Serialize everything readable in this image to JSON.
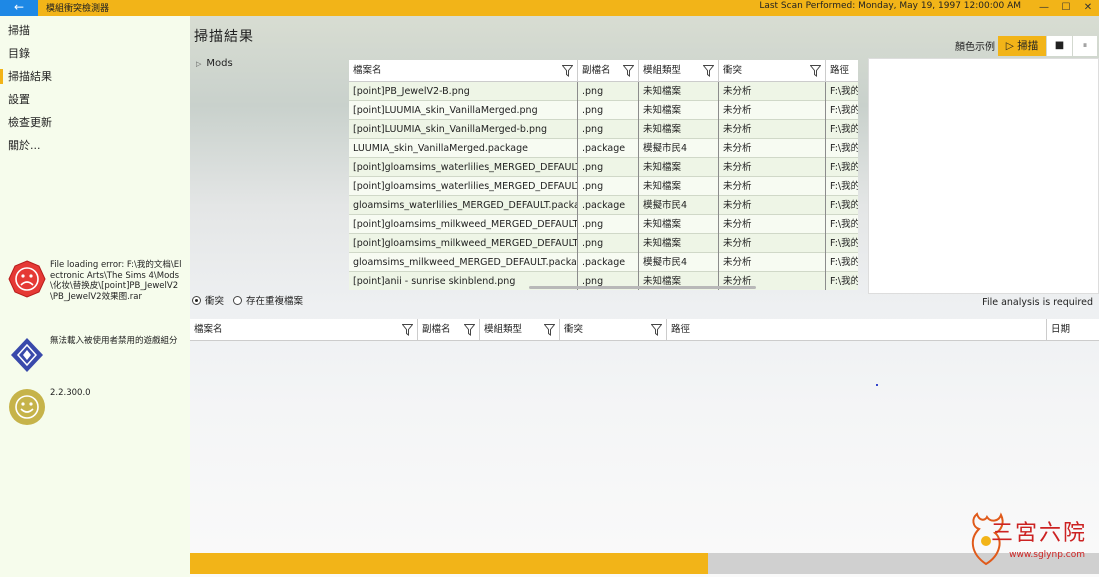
{
  "titlebar": {
    "back_icon": "←",
    "title": "模組衝突檢測器",
    "scan_info": "Last Scan Performed: Monday, May 19, 1997 12:00:00 AM",
    "minimize": "—",
    "maximize": "☐",
    "close": "✕"
  },
  "sidebar": {
    "items": [
      {
        "label": "掃描"
      },
      {
        "label": "目錄"
      },
      {
        "label": "掃描結果"
      },
      {
        "label": "設置"
      },
      {
        "label": "檢查更新"
      },
      {
        "label": "關於..."
      }
    ],
    "active_index": 2,
    "notices": [
      {
        "icon": "error-face-icon",
        "text": "File loading error: F:\\我的文档\\Electronic Arts\\The Sims 4\\Mods\\化妆\\替换皮\\[point]PB_JewelV2\\PB_JewelV2效果图.rar"
      },
      {
        "icon": "diamond-warning-icon",
        "text": "無法載入被使用者禁用的遊戲組分"
      },
      {
        "icon": "smile-face-icon",
        "text": "2.2.300.0"
      }
    ]
  },
  "main": {
    "title": "掃描結果",
    "legend_label": "顏色示例",
    "scan_button": "掃描",
    "scan_icon": "▷",
    "stop_icon": "■",
    "pause_icon": "⏸",
    "tree": {
      "label": "Mods"
    },
    "columns": [
      "檔案名",
      "副檔名",
      "模組類型",
      "衝突",
      "路徑"
    ],
    "rows": [
      [
        "[point]PB_JewelV2-B.png",
        ".png",
        "未知檔案",
        "未分析",
        "F:\\我的"
      ],
      [
        "[point]LUUMIA_skin_VanillaMerged.png",
        ".png",
        "未知檔案",
        "未分析",
        "F:\\我的"
      ],
      [
        "[point]LUUMIA_skin_VanillaMerged-b.png",
        ".png",
        "未知檔案",
        "未分析",
        "F:\\我的"
      ],
      [
        "LUUMIA_skin_VanillaMerged.package",
        ".package",
        "模擬市民4",
        "未分析",
        "F:\\我的"
      ],
      [
        "[point]gloamsims_waterlilies_MERGED_DEFAULT.png",
        ".png",
        "未知檔案",
        "未分析",
        "F:\\我的"
      ],
      [
        "[point]gloamsims_waterlilies_MERGED_DEFAULT-b.png",
        ".png",
        "未知檔案",
        "未分析",
        "F:\\我的"
      ],
      [
        "gloamsims_waterlilies_MERGED_DEFAULT.package",
        ".package",
        "模擬市民4",
        "未分析",
        "F:\\我的"
      ],
      [
        "[point]gloamsims_milkweed_MERGED_DEFAULT.png",
        ".png",
        "未知檔案",
        "未分析",
        "F:\\我的"
      ],
      [
        "[point]gloamsims_milkweed_MERGED_DEFAULT-b.png",
        ".png",
        "未知檔案",
        "未分析",
        "F:\\我的"
      ],
      [
        "gloamsims_milkweed_MERGED_DEFAULT.package",
        ".package",
        "模擬市民4",
        "未分析",
        "F:\\我的"
      ],
      [
        "[point]anii - sunrise skinblend.png",
        ".png",
        "未知檔案",
        "未分析",
        "F:\\我的"
      ]
    ],
    "radio_conflict": "衝突",
    "radio_duplicate": "存在重複檔案",
    "analysis_status": "File analysis is required",
    "bottom_columns": [
      "檔案名",
      "副檔名",
      "模組類型",
      "衝突",
      "路徑",
      "日期"
    ],
    "progress": 0.57
  },
  "watermark": {
    "text": "三宮六院",
    "url": "www.sglynp.com"
  }
}
